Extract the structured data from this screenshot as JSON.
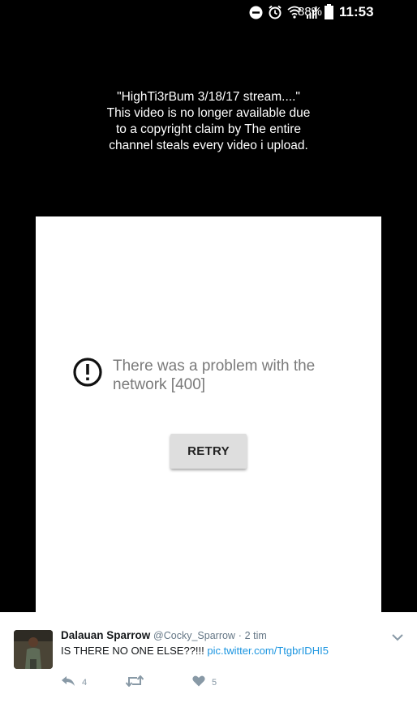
{
  "status_bar": {
    "battery_percent": "88%",
    "time": "11:53",
    "icons": [
      "do-not-disturb-icon",
      "alarm-icon",
      "wifi-icon",
      "signal-icon",
      "battery-icon"
    ]
  },
  "video": {
    "message_lines": [
      "\"HighTi3rBum 3/18/17 stream....\"",
      "This video is no longer available due",
      "to a copyright claim by The entire",
      "channel steals every video i upload."
    ]
  },
  "dialog": {
    "error_lines": [
      "There was a problem with the",
      "network [400]"
    ],
    "retry_label": "RETRY"
  },
  "tweet": {
    "display_name": "Dalauan Sparrow",
    "handle": "@Cocky_Sparrow",
    "separator": "·",
    "time_ago": "2 tim",
    "text": "IS THERE NO ONE ELSE??!!!",
    "link": "pic.twitter.com/TtgbrIDHI5",
    "reply_count": "4",
    "retweet_count": "",
    "like_count": "5",
    "colors": {
      "link": "#1b95e0",
      "muted": "#657786"
    }
  }
}
